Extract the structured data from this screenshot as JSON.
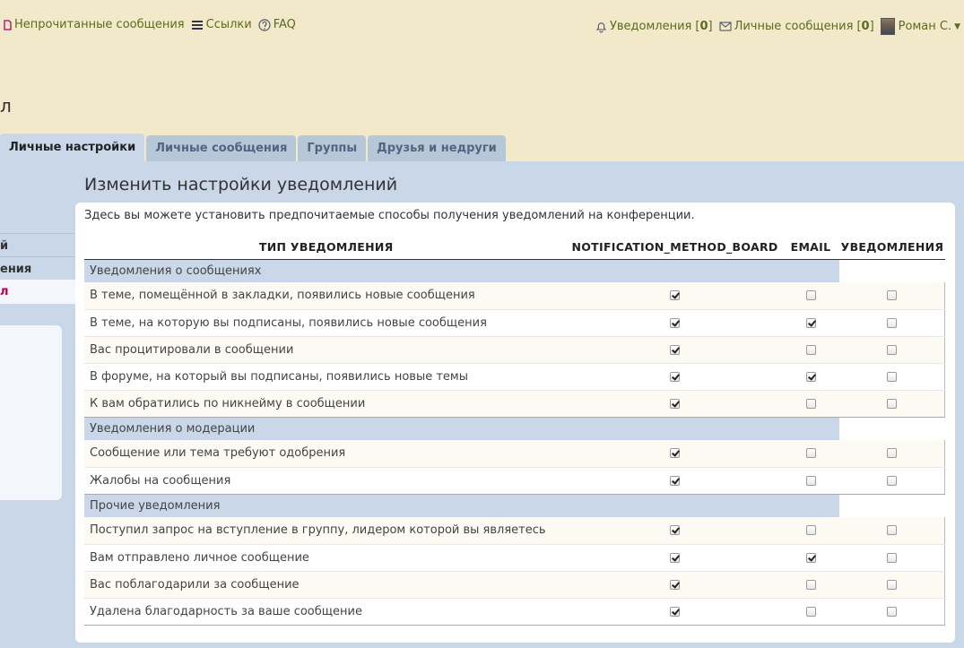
{
  "nav": {
    "unread": "Непрочитанные сообщения",
    "links": "Ссылки",
    "faq": "FAQ",
    "notifications_label": "Уведомления",
    "notifications_count": "0",
    "pm_label": "Личные сообщения",
    "pm_count": "0",
    "user": "Роман С.",
    "icons": [
      "document-icon",
      "list-icon",
      "help-icon",
      "bell-icon",
      "envelope-icon",
      "avatar",
      "caret-down-icon"
    ]
  },
  "page_title_fragment": "л",
  "tabs": [
    {
      "label": "Личные настройки",
      "active": true
    },
    {
      "label": "Личные сообщения",
      "active": false
    },
    {
      "label": "Группы",
      "active": false
    },
    {
      "label": "Друзья и недруги",
      "active": false
    }
  ],
  "sidebar": {
    "items": [
      {
        "label": "й"
      },
      {
        "label": "ения"
      },
      {
        "label": "л"
      }
    ]
  },
  "section_title": "Изменить настройки уведомлений",
  "description": "Здесь вы можете установить предпочитаемые способы получения уведомлений на конференции.",
  "table": {
    "headers": [
      "ТИП УВЕДОМЛЕНИЯ",
      "NOTIFICATION_METHOD_BOARD",
      "EMAIL",
      "УВЕДОМЛЕНИЯ"
    ],
    "groups": [
      {
        "title": "Уведомления о сообщениях",
        "rows": [
          {
            "name": "В теме, помещённой в закладки, появились новые сообщения",
            "board": true,
            "email": false,
            "notif": false
          },
          {
            "name": "В теме, на которую вы подписаны, появились новые сообщения",
            "board": true,
            "email": true,
            "notif": false
          },
          {
            "name": "Вас процитировали в сообщении",
            "board": true,
            "email": false,
            "notif": false
          },
          {
            "name": "В форуме, на который вы подписаны, появились новые темы",
            "board": true,
            "email": true,
            "notif": false
          },
          {
            "name": "К вам обратились по никнейму в сообщении",
            "board": true,
            "email": false,
            "notif": false
          }
        ]
      },
      {
        "title": "Уведомления о модерации",
        "rows": [
          {
            "name": "Сообщение или тема требуют одобрения",
            "board": true,
            "email": false,
            "notif": false
          },
          {
            "name": "Жалобы на сообщения",
            "board": true,
            "email": false,
            "notif": false
          }
        ]
      },
      {
        "title": "Прочие уведомления",
        "rows": [
          {
            "name": "Поступил запрос на вступление в группу, лидером которой вы являетесь",
            "board": true,
            "email": false,
            "notif": false
          },
          {
            "name": "Вам отправлено личное сообщение",
            "board": true,
            "email": true,
            "notif": false
          },
          {
            "name": "Вас поблагодарили за сообщение",
            "board": true,
            "email": false,
            "notif": false
          },
          {
            "name": "Удалена благодарность за ваше сообщение",
            "board": true,
            "email": false,
            "notif": false
          }
        ]
      }
    ]
  }
}
